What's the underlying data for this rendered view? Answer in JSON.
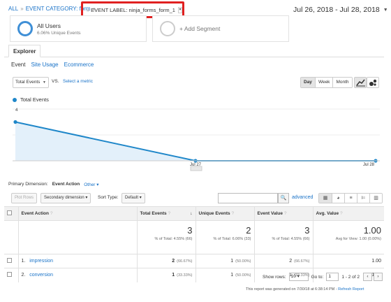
{
  "breadcrumb": {
    "all": "ALL",
    "category": "EVENT CATEGORY: form",
    "label": "EVENT LABEL: ninja_forms_form_1"
  },
  "date_range": "Jul 26, 2018 - Jul 28, 2018",
  "segments": {
    "all_users_title": "All Users",
    "all_users_sub": "6.06% Unique Events",
    "add_segment": "+ Add Segment"
  },
  "explorer_tab": "Explorer",
  "subtabs": [
    "Event",
    "Site Usage",
    "Ecommerce"
  ],
  "metric": {
    "selected": "Total Events",
    "vs": "VS.",
    "select_metric": "Select a metric"
  },
  "time_buttons": [
    "Day",
    "Week",
    "Month"
  ],
  "legend": "Total Events",
  "chart_data": {
    "type": "line",
    "series": [
      {
        "name": "Total Events",
        "values": [
          3,
          0,
          0
        ]
      }
    ],
    "x": [
      "Jul 26",
      "Jul 27",
      "Jul 28"
    ],
    "x_tick_labels": [
      "Jul 27",
      "Jul 28"
    ],
    "y_ticks": [
      "4",
      "2"
    ],
    "ylim": [
      0,
      4
    ],
    "color": "#1f87c9",
    "fill": "#e3f0fa"
  },
  "primary_dimension": {
    "label": "Primary Dimension:",
    "value": "Event Action",
    "other": "Other"
  },
  "toolbar": {
    "plot_rows": "Plot Rows",
    "secondary": "Secondary dimension",
    "sort_label": "Sort Type:",
    "sort_value": "Default",
    "advanced": "advanced"
  },
  "table": {
    "headers": [
      "Event Action",
      "Total Events",
      "Unique Events",
      "Event Value",
      "Avg. Value"
    ],
    "totals": {
      "total_events": "3",
      "total_events_sub": "% of Total: 4.55% (66)",
      "unique_events": "2",
      "unique_events_sub": "% of Total: 6.06% (33)",
      "event_value": "3",
      "event_value_sub": "% of Total: 4.55% (66)",
      "avg_value": "1.00",
      "avg_value_sub": "Avg for View: 1.00 (0.00%)"
    },
    "rows": [
      {
        "index": "1.",
        "action": "impression",
        "total": "2",
        "total_pct": "(66.67%)",
        "unique": "1",
        "unique_pct": "(50.00%)",
        "value": "2",
        "value_pct": "(66.67%)",
        "avg": "1.00"
      },
      {
        "index": "2.",
        "action": "conversion",
        "total": "1",
        "total_pct": "(33.33%)",
        "unique": "1",
        "unique_pct": "(50.00%)",
        "value": "1",
        "value_pct": "(33.33%)",
        "avg": "1.00"
      }
    ]
  },
  "pager": {
    "show_rows": "Show rows:",
    "rows_value": "10",
    "goto": "Go to:",
    "page": "1",
    "range": "1 - 2 of 2"
  },
  "footnote": {
    "text": "This report was generated on 7/30/18 at 6:38:14 PM -",
    "refresh": "Refresh Report"
  }
}
